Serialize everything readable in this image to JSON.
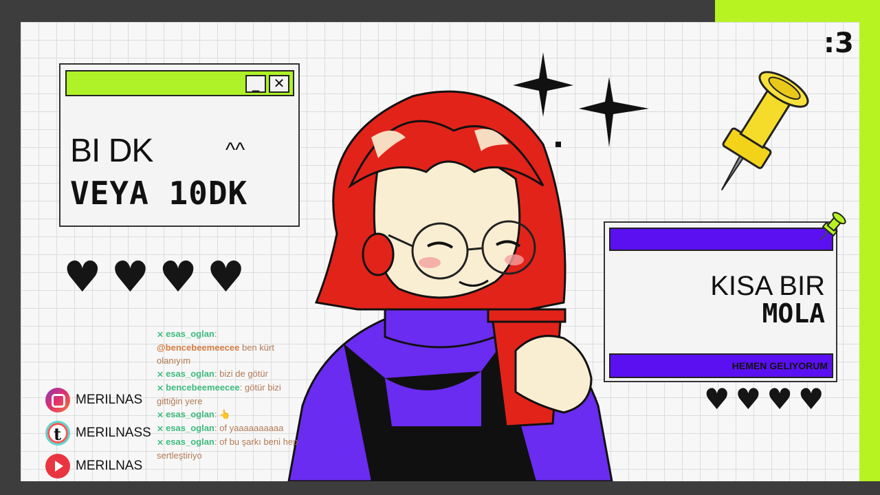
{
  "corner_text": ":3",
  "window_1": {
    "min_label": "_",
    "close_label": "✕",
    "line1": "BI DK",
    "emote": "^^",
    "line2": "VEYA 10DK"
  },
  "window_2": {
    "line1": "KISA BIR",
    "line2": "MOLA",
    "footer": "HEMEN GELIYORUM"
  },
  "hearts": {
    "left_count": 4,
    "right_count": 4,
    "glyph": "♥"
  },
  "chat": [
    {
      "user": "esas_oglan",
      "sep": ": ",
      "mention": "@bencebeemeecee",
      "text": " ben kürt olanıyım"
    },
    {
      "user": "esas_oglan",
      "sep": ": ",
      "mention": "",
      "text": "bizi de götür"
    },
    {
      "user": "bencebeemeecee",
      "sep": ": ",
      "mention": "",
      "text": "götür bizi gittiğin yere"
    },
    {
      "user": "esas_oglan",
      "sep": ": ",
      "mention": "",
      "text": "👆"
    },
    {
      "user": "esas_oglan",
      "sep": ": ",
      "mention": "",
      "text": "of yaaaaaaaaaa"
    },
    {
      "user": "esas_oglan",
      "sep": ": ",
      "mention": "",
      "text": "of bu şarkı beni hep sertleştiriyo"
    }
  ],
  "chat_badge": "⨯",
  "socials": [
    {
      "platform": "instagram",
      "icon": "instagram-icon",
      "handle": "MERILNAS"
    },
    {
      "platform": "tiktok",
      "icon": "tiktok-icon",
      "handle": "MERILNASS"
    },
    {
      "platform": "youtube",
      "icon": "youtube-icon",
      "handle": "MERILNAS"
    }
  ],
  "colors": {
    "accent_green": "#b6f321",
    "accent_purple": "#5a10f0",
    "hair_red": "#e2231a",
    "sweater_purple": "#6a2cf0"
  }
}
